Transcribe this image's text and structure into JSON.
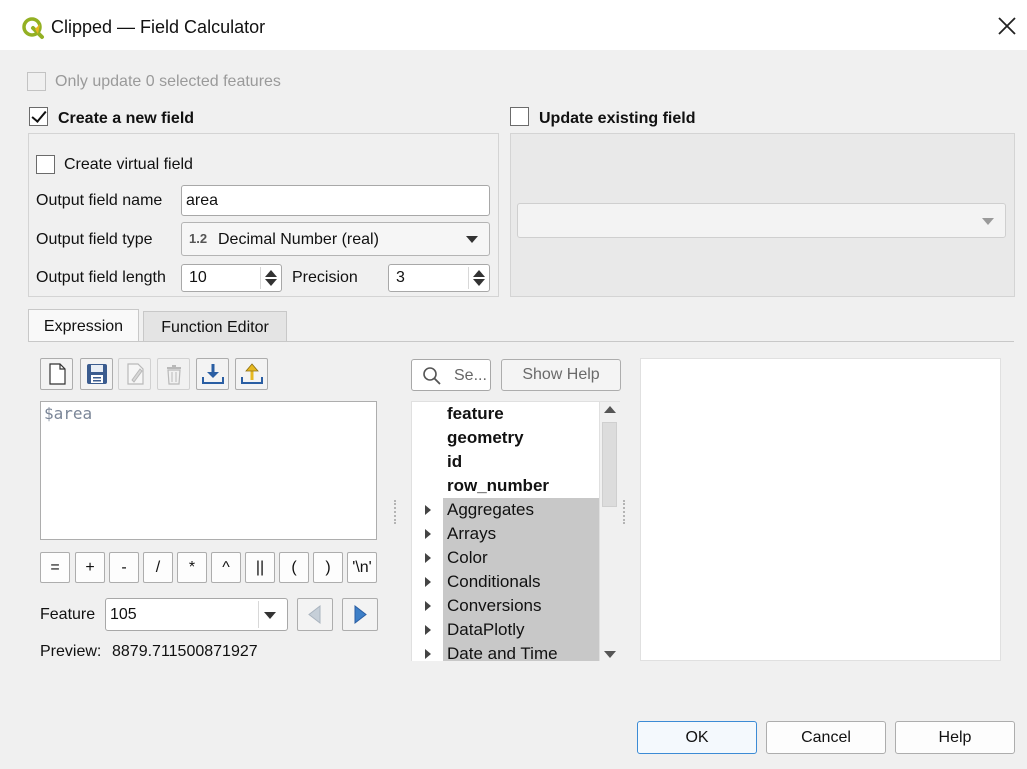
{
  "window": {
    "title": "Clipped — Field Calculator",
    "icon": "qgis-logo",
    "accent_color": "#3c8bd5"
  },
  "only_update": {
    "label": "Only update 0 selected features",
    "checked": false,
    "enabled": false
  },
  "create_field": {
    "label": "Create a new field",
    "checked": true,
    "virtual_label": "Create virtual field",
    "virtual_checked": false,
    "name_label": "Output field name",
    "name_value": "area",
    "type_label": "Output field type",
    "type_badge": "1.2",
    "type_value": "Decimal Number (real)",
    "length_label": "Output field length",
    "length_value": "10",
    "precision_label": "Precision",
    "precision_value": "3"
  },
  "update_field": {
    "label": "Update existing field",
    "checked": false,
    "value": ""
  },
  "tabs": [
    {
      "label": "Expression",
      "active": true
    },
    {
      "label": "Function Editor",
      "active": false
    }
  ],
  "toolbar": {
    "buttons": [
      {
        "name": "new-file-icon",
        "enabled": true
      },
      {
        "name": "save-icon",
        "enabled": true
      },
      {
        "name": "edit-icon",
        "enabled": false
      },
      {
        "name": "delete-icon",
        "enabled": false
      },
      {
        "name": "import-icon",
        "enabled": true
      },
      {
        "name": "export-icon",
        "enabled": true
      }
    ]
  },
  "expression": {
    "text": "$area"
  },
  "operators": [
    "=",
    "+",
    "-",
    "/",
    "*",
    "^",
    "||",
    "(",
    ")",
    "'\\n'"
  ],
  "feature": {
    "label": "Feature",
    "value": "105"
  },
  "preview": {
    "label": "Preview:",
    "value": "8879.711500871927"
  },
  "search": {
    "placeholder": "Se..."
  },
  "show_help_label": "Show Help",
  "functions": {
    "fields": [
      "feature",
      "geometry",
      "id",
      "row_number"
    ],
    "groups": [
      "Aggregates",
      "Arrays",
      "Color",
      "Conditionals",
      "Conversions",
      "DataPlotly",
      "Date and Time"
    ]
  },
  "buttons": {
    "ok": "OK",
    "cancel": "Cancel",
    "help": "Help"
  }
}
